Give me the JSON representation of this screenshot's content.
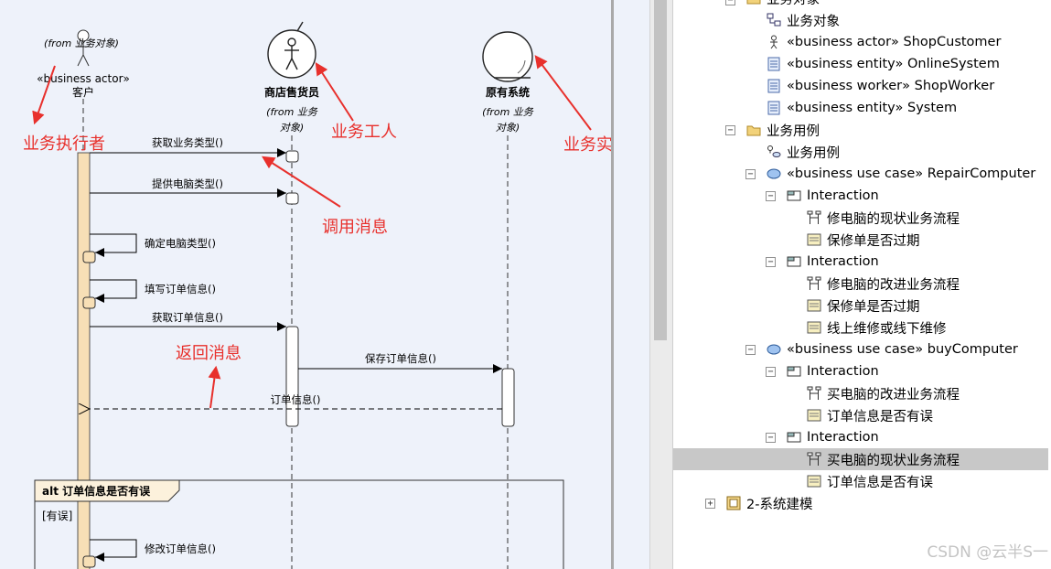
{
  "diagram": {
    "actor": {
      "from": "(from 业务对象)",
      "stereotype": "«business actor»",
      "name": "客户"
    },
    "worker": {
      "name": "商店售货员",
      "from1": "(from 业务",
      "from2": "对象)"
    },
    "entity": {
      "name": "原有系统",
      "from1": "(from 业务",
      "from2": "对象)"
    },
    "messages": [
      {
        "label": "获取业务类型()"
      },
      {
        "label": "提供电脑类型()"
      },
      {
        "label": "确定电脑类型()"
      },
      {
        "label": "填写订单信息()"
      },
      {
        "label": "获取订单信息()"
      },
      {
        "label": "保存订单信息()"
      },
      {
        "label": "订单信息()"
      },
      {
        "label": "修改订单信息()"
      }
    ],
    "fragment": {
      "title": "alt 订单信息是否有误",
      "guard": "[有误]"
    },
    "annotations": {
      "actor": "业务执行者",
      "worker": "业务工人",
      "entity": "业务实体",
      "call": "调用消息",
      "return": "返回消息"
    },
    "annotation_color": "#e8302c",
    "lifeline_activation_color": "#f7dfb6"
  },
  "tree": {
    "rows": [
      {
        "text": "业务对象",
        "icon": "folder-icon"
      },
      {
        "text": "业务对象",
        "icon": "class-diagram-icon"
      },
      {
        "text": "«business actor» ShopCustomer",
        "icon": "actor-icon"
      },
      {
        "text": "«business entity» OnlineSystem",
        "icon": "entity-icon"
      },
      {
        "text": "«business worker» ShopWorker",
        "icon": "entity-icon"
      },
      {
        "text": "«business entity» System",
        "icon": "entity-icon"
      },
      {
        "text": "业务用例",
        "icon": "folder-icon"
      },
      {
        "text": "业务用例",
        "icon": "usecase-diagram-icon"
      },
      {
        "text": "«business use case» RepairComputer",
        "icon": "usecase-icon"
      },
      {
        "text": "Interaction",
        "icon": "interaction-icon"
      },
      {
        "text": "修电脑的现状业务流程",
        "icon": "sequence-icon"
      },
      {
        "text": "保修单是否过期",
        "icon": "note-icon"
      },
      {
        "text": "Interaction",
        "icon": "interaction-icon"
      },
      {
        "text": "修电脑的改进业务流程",
        "icon": "sequence-icon"
      },
      {
        "text": "保修单是否过期",
        "icon": "note-icon"
      },
      {
        "text": "线上维修或线下维修",
        "icon": "note-icon"
      },
      {
        "text": "«business use case» buyComputer",
        "icon": "usecase-icon"
      },
      {
        "text": "Interaction",
        "icon": "interaction-icon"
      },
      {
        "text": "买电脑的改进业务流程",
        "icon": "sequence-icon"
      },
      {
        "text": "订单信息是否有误",
        "icon": "note-icon"
      },
      {
        "text": "Interaction",
        "icon": "interaction-icon"
      },
      {
        "text": "买电脑的现状业务流程",
        "icon": "sequence-icon"
      },
      {
        "text": "订单信息是否有误",
        "icon": "note-icon"
      },
      {
        "text": "2-系统建模",
        "icon": "package-icon"
      }
    ]
  },
  "watermark": "CSDN @云半S一"
}
